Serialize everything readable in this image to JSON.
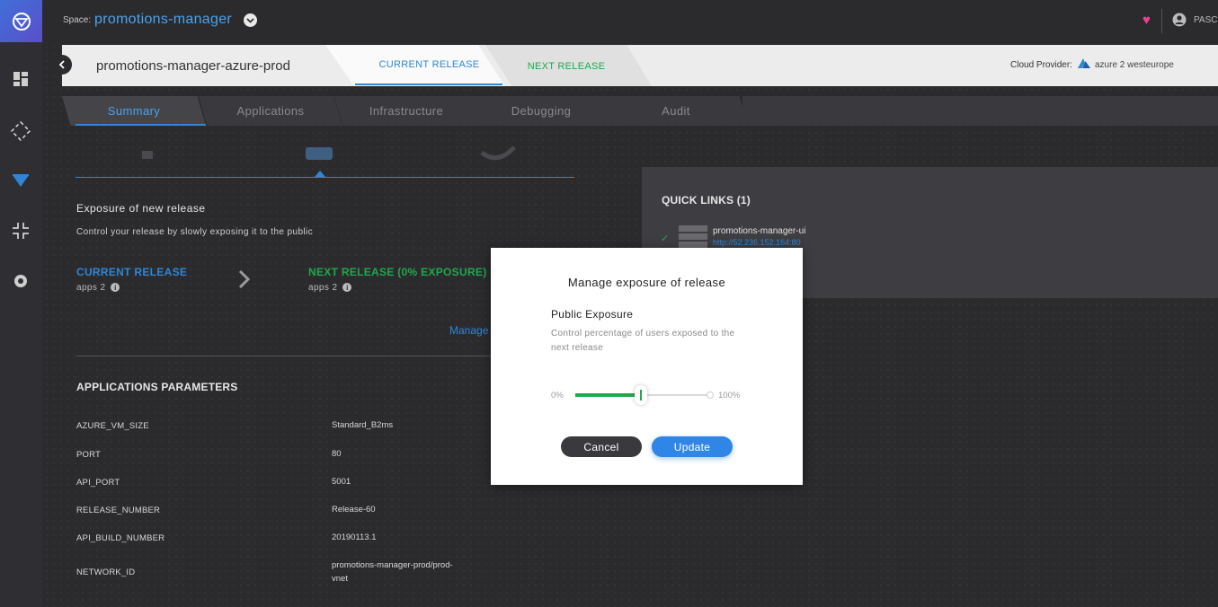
{
  "topbar": {
    "space_label": "Space:",
    "space_name": "promotions-manager",
    "user_name": "PASC"
  },
  "release_header": {
    "env_title": "promotions-manager-azure-prod",
    "tab_current": "CURRENT RELEASE",
    "tab_next": "NEXT RELEASE",
    "cloud_label": "Cloud Provider:",
    "cloud_value": "azure 2 westeurope"
  },
  "section_tabs": [
    {
      "label": "Summary"
    },
    {
      "label": "Applications"
    },
    {
      "label": "Infrastructure"
    },
    {
      "label": "Debugging"
    },
    {
      "label": "Audit"
    }
  ],
  "exposure": {
    "title": "Exposure of new release",
    "subtitle": "Control your release by slowly exposing it to the public",
    "current_label": "CURRENT RELEASE",
    "current_apps": "apps 2",
    "next_label": "NEXT RELEASE (0% EXPOSURE)",
    "next_apps": "apps 2",
    "manage_link": "Manage"
  },
  "params": {
    "title": "APPLICATIONS PARAMETERS",
    "rows": [
      {
        "key": "AZURE_VM_SIZE",
        "value": "Standard_B2ms"
      },
      {
        "key": "PORT",
        "value": "80"
      },
      {
        "key": "API_PORT",
        "value": "5001"
      },
      {
        "key": "RELEASE_NUMBER",
        "value": "Release-60"
      },
      {
        "key": "API_BUILD_NUMBER",
        "value": "20190113.1"
      },
      {
        "key": "NETWORK_ID",
        "value": "promotions-manager-prod/prod-vnet"
      }
    ]
  },
  "quick_links": {
    "title": "QUICK LINKS (1)",
    "item_name": "promotions-manager-ui",
    "item_url": "http://52.236.152.164:80"
  },
  "modal": {
    "title": "Manage exposure of release",
    "section_title": "Public Exposure",
    "section_desc": "Control percentage of users exposed to the next release",
    "slider_min": "0%",
    "slider_max": "100%",
    "slider_value_pct": 50,
    "cancel_label": "Cancel",
    "update_label": "Update"
  },
  "colors": {
    "accent_blue": "#2f86d6",
    "accent_green": "#1fa84c",
    "heart_pink": "#e6458f"
  }
}
